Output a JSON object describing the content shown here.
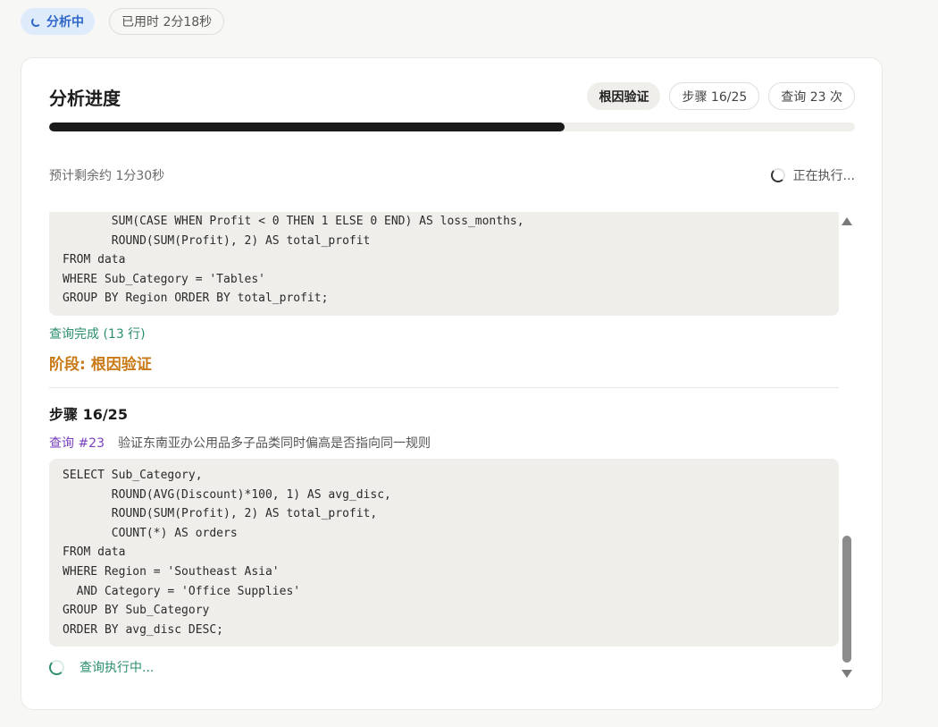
{
  "status": {
    "label": "分析中",
    "elapsed": "已用时 2分18秒"
  },
  "card": {
    "title": "分析进度",
    "phase_badge": "根因验证",
    "step_badge": "步骤 16/25",
    "query_badge": "查询 23 次",
    "progress_fraction": 0.64,
    "eta": "预计剩余约 1分30秒",
    "running_label": "正在执行..."
  },
  "log": {
    "prev_code": "       SUM(CASE WHEN Profit < 0 THEN 1 ELSE 0 END) AS loss_months,\n       ROUND(SUM(Profit), 2) AS total_profit\nFROM data\nWHERE Sub_Category = 'Tables'\nGROUP BY Region ORDER BY total_profit;",
    "prev_result": "查询完成 (13 行)",
    "phase_label": "阶段: 根因验证",
    "step_title": "步骤 16/25",
    "query_no": "查询 #23",
    "query_desc": "验证东南亚办公用品多子品类同时偏高是否指向同一规则",
    "code": "SELECT Sub_Category,\n       ROUND(AVG(Discount)*100, 1) AS avg_disc,\n       ROUND(SUM(Profit), 2) AS total_profit,\n       COUNT(*) AS orders\nFROM data\nWHERE Region = 'Southeast Asia'\n  AND Category = 'Office Supplies'\nGROUP BY Sub_Category\nORDER BY avg_disc DESC;",
    "exec_label": "查询执行中..."
  },
  "colors": {
    "accent_blue": "#2f66c7",
    "success_green": "#2a8f6a",
    "phase_orange": "#c97a16",
    "query_purple": "#7a3fbf"
  }
}
